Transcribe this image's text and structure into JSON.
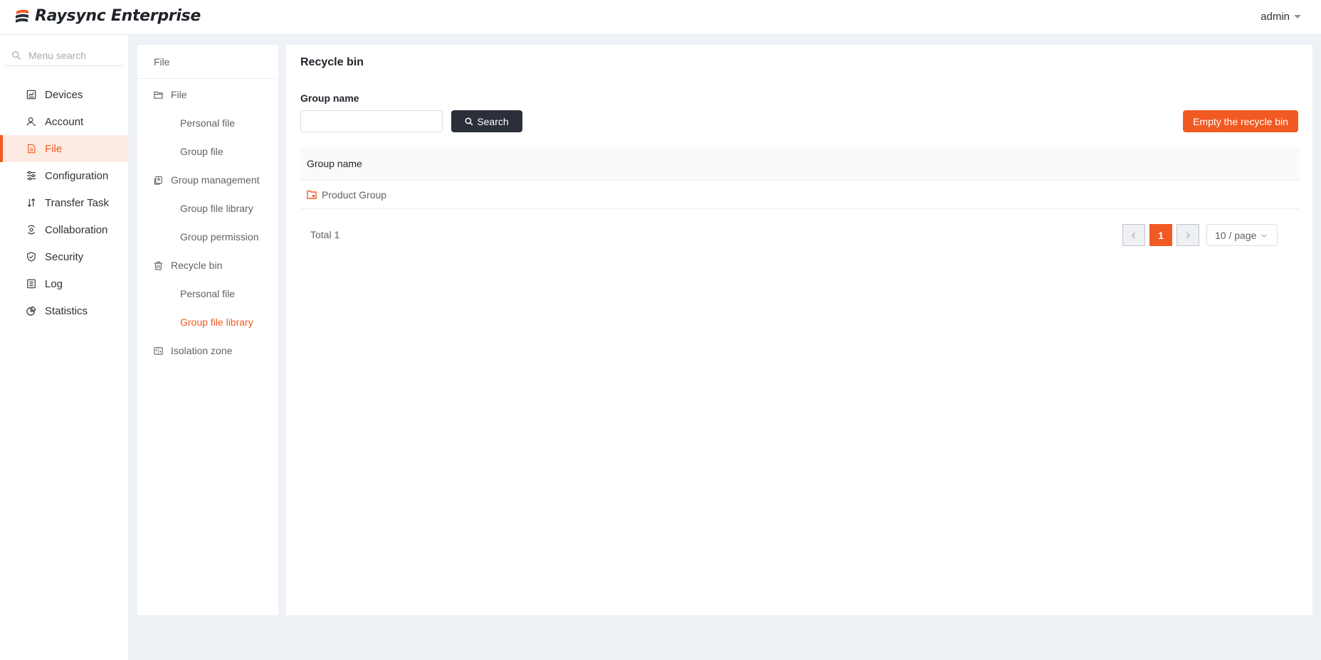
{
  "app": {
    "title": "Raysync Enterprise",
    "user": "admin"
  },
  "colors": {
    "accent": "#f15a22",
    "dark_button": "#2b2f3a"
  },
  "sidebar": {
    "search_placeholder": "Menu search",
    "items": [
      {
        "label": "Devices",
        "icon": "devices-icon"
      },
      {
        "label": "Account",
        "icon": "account-icon"
      },
      {
        "label": "File",
        "icon": "file-icon",
        "active": true
      },
      {
        "label": "Configuration",
        "icon": "configuration-icon"
      },
      {
        "label": "Transfer Task",
        "icon": "transfer-icon"
      },
      {
        "label": "Collaboration",
        "icon": "collaboration-icon"
      },
      {
        "label": "Security",
        "icon": "security-icon"
      },
      {
        "label": "Log",
        "icon": "log-icon"
      },
      {
        "label": "Statistics",
        "icon": "statistics-icon"
      }
    ]
  },
  "subnav": {
    "title": "File",
    "groups": [
      {
        "label": "File",
        "icon": "folder-icon",
        "items": [
          "Personal file",
          "Group file"
        ]
      },
      {
        "label": "Group management",
        "icon": "group-management-icon",
        "items": [
          "Group file library",
          "Group permission"
        ]
      },
      {
        "label": "Recycle bin",
        "icon": "trash-icon",
        "items": [
          "Personal file",
          "Group file library"
        ],
        "active_item": "Group file library"
      },
      {
        "label": "Isolation zone",
        "icon": "isolation-zone-icon",
        "items": []
      }
    ]
  },
  "main": {
    "title": "Recycle bin",
    "filter_label": "Group name",
    "filter_value": "",
    "search_label": "Search",
    "empty_label": "Empty the recycle bin",
    "table": {
      "columns": [
        "Group name"
      ],
      "rows": [
        {
          "name": "Product Group",
          "icon": "group-folder-icon"
        }
      ]
    },
    "pagination": {
      "total_label": "Total 1",
      "current_page": "1",
      "page_size": "10 / page"
    }
  }
}
